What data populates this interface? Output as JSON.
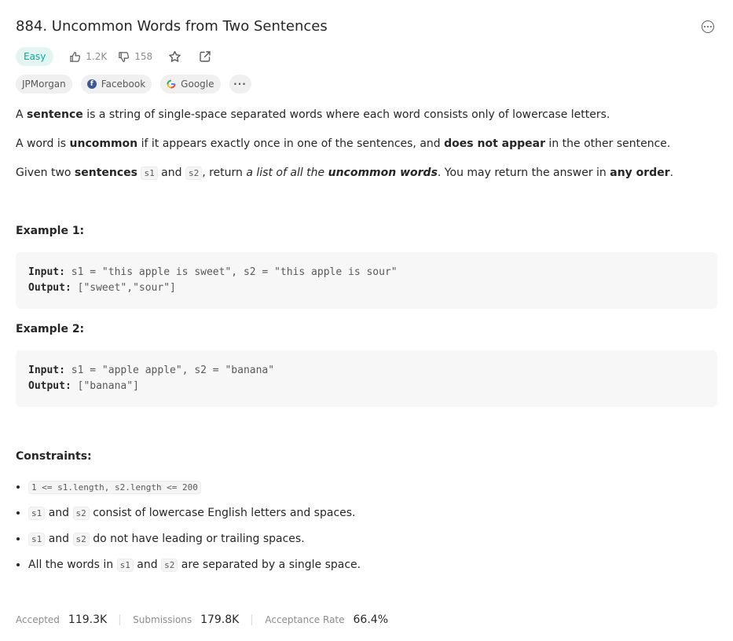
{
  "problem": {
    "title": "884. Uncommon Words from Two Sentences",
    "difficulty": "Easy",
    "likes": "1.2K",
    "dislikes": "158"
  },
  "tags": [
    {
      "label": "JPMorgan",
      "icon": ""
    },
    {
      "label": "Facebook",
      "icon": "facebook-icon"
    },
    {
      "label": "Google",
      "icon": "google-icon"
    },
    {
      "label": "···",
      "icon": "more-horizontal-icon"
    }
  ],
  "description": {
    "p1": {
      "a": "A ",
      "b": "sentence",
      "c": " is a string of single-space separated words where each word consists only of lowercase letters."
    },
    "p2": {
      "a": "A word is ",
      "b": "uncommon",
      "c": " if it appears exactly once in one of the sentences, and ",
      "d": "does not appear",
      "e": " in the other sentence."
    },
    "p3": {
      "a": "Given two ",
      "b": "sentences",
      "c": " ",
      "code1": "s1",
      "d": " and ",
      "code2": "s2",
      "e": ", return ",
      "f": "a list of all the ",
      "g": "uncommon words",
      "h": ". You may return the answer in ",
      "i": "any order",
      "j": "."
    }
  },
  "examples": [
    {
      "heading": "Example 1:",
      "input_label": "Input:",
      "input": " s1 = \"this apple is sweet\", s2 = \"this apple is sour\"",
      "output_label": "Output:",
      "output": " [\"sweet\",\"sour\"]"
    },
    {
      "heading": "Example 2:",
      "input_label": "Input:",
      "input": " s1 = \"apple apple\", s2 = \"banana\"",
      "output_label": "Output:",
      "output": " [\"banana\"]"
    }
  ],
  "constraints": {
    "heading": "Constraints:",
    "c1": "1 <= s1.length, s2.length <= 200",
    "c2": {
      "code1": "s1",
      "and": " and ",
      "code2": "s2",
      "text": " consist of lowercase English letters and spaces."
    },
    "c3": {
      "code1": "s1",
      "and": " and ",
      "code2": "s2",
      "text": " do not have leading or trailing spaces."
    },
    "c4": {
      "pre": "All the words in ",
      "code1": "s1",
      "and": " and ",
      "code2": "s2",
      "text": " are separated by a single space."
    }
  },
  "stats": {
    "accepted_label": "Accepted",
    "accepted": "119.3K",
    "submissions_label": "Submissions",
    "submissions": "179.8K",
    "rate_label": "Acceptance Rate",
    "rate": "66.4%"
  },
  "colors": {
    "easy": "#00af9b",
    "facebook": "#3b5998"
  }
}
